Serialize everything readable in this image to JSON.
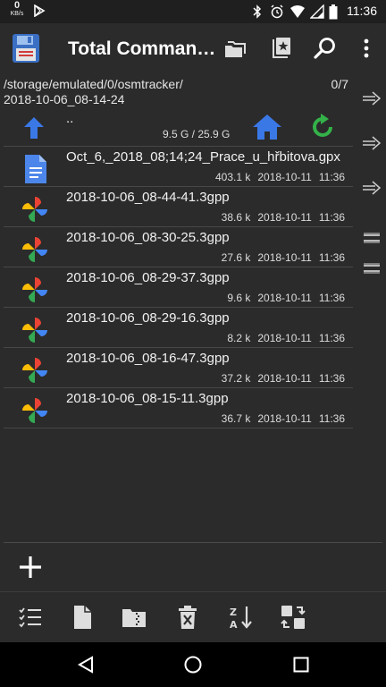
{
  "status_bar": {
    "net_speed": "0",
    "net_unit": "KB/s",
    "time": "11:36"
  },
  "app_bar": {
    "title": "Total Comman…"
  },
  "path": {
    "line1": "/storage/emulated/0/osmtracker/",
    "line2": "2018-10-06_08-14-24",
    "count": "0/7"
  },
  "up_row": {
    "label": "..",
    "storage": "9.5 G / 25.9 G"
  },
  "files": [
    {
      "name": "Oct_6,_2018_08;14;24_Prace_u_hřbitova.gpx",
      "size": "403.1 k",
      "date": "2018-10-11",
      "time": "11:36",
      "icon": "document-icon"
    },
    {
      "name": "2018-10-06_08-44-41.3gpp",
      "size": "38.6 k",
      "date": "2018-10-11",
      "time": "11:36",
      "icon": "media-pinwheel-icon"
    },
    {
      "name": "2018-10-06_08-30-25.3gpp",
      "size": "27.6 k",
      "date": "2018-10-11",
      "time": "11:36",
      "icon": "media-pinwheel-icon"
    },
    {
      "name": "2018-10-06_08-29-37.3gpp",
      "size": "9.6 k",
      "date": "2018-10-11",
      "time": "11:36",
      "icon": "media-pinwheel-icon"
    },
    {
      "name": "2018-10-06_08-29-16.3gpp",
      "size": "8.2 k",
      "date": "2018-10-11",
      "time": "11:36",
      "icon": "media-pinwheel-icon"
    },
    {
      "name": "2018-10-06_08-16-47.3gpp",
      "size": "37.2 k",
      "date": "2018-10-11",
      "time": "11:36",
      "icon": "media-pinwheel-icon"
    },
    {
      "name": "2018-10-06_08-15-11.3gpp",
      "size": "36.7 k",
      "date": "2018-10-11",
      "time": "11:36",
      "icon": "media-pinwheel-icon"
    }
  ],
  "colors": {
    "background": "#2b2b2b",
    "accent_blue": "#3a78e6",
    "refresh_green": "#33b249"
  }
}
